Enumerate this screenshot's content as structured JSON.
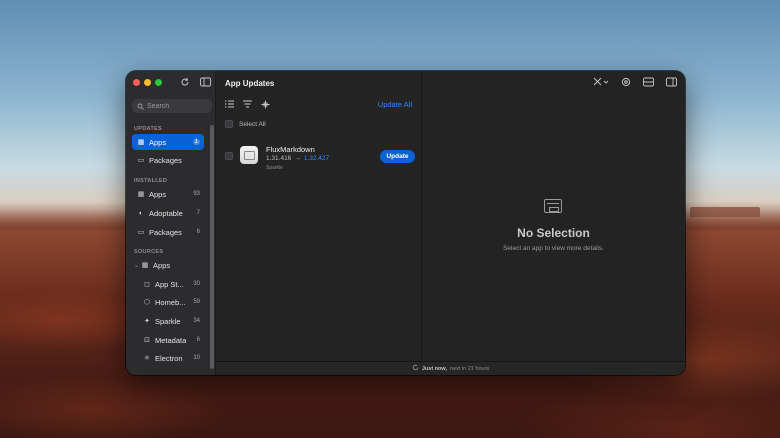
{
  "window": {
    "title": "App Updates"
  },
  "sidebar": {
    "search_placeholder": "Search",
    "sections": {
      "updates": "UPDATES",
      "installed": "INSTALLED",
      "sources": "SOURCES"
    },
    "updates_items": [
      {
        "label": "Apps",
        "count": "1",
        "icon": "grid-icon"
      },
      {
        "label": "Packages",
        "count": "",
        "icon": "package-icon"
      }
    ],
    "installed_items": [
      {
        "label": "Apps",
        "count": "93",
        "icon": "grid-icon"
      },
      {
        "label": "Adoptable",
        "count": "7",
        "icon": "adopt-icon"
      },
      {
        "label": "Packages",
        "count": "6",
        "icon": "package-icon"
      }
    ],
    "sources_group": {
      "label": "Apps",
      "icon": "grid-icon"
    },
    "sources_items": [
      {
        "label": "App St...",
        "count": "30",
        "icon": "bag-icon"
      },
      {
        "label": "Homeb...",
        "count": "59",
        "icon": "cube-icon"
      },
      {
        "label": "Sparkle",
        "count": "34",
        "icon": "sparkle-icon"
      },
      {
        "label": "Metadata",
        "count": "6",
        "icon": "metadata-icon"
      },
      {
        "label": "Electron",
        "count": "10",
        "icon": "atom-icon"
      }
    ]
  },
  "middle": {
    "update_all": "Update All",
    "select_all": "Select All",
    "app": {
      "name": "FluxMarkdown",
      "old_version": "1.31.416",
      "arrow": "→",
      "new_version": "1.32.427",
      "source": "Sparkle",
      "button": "Update"
    }
  },
  "detail": {
    "title": "No Selection",
    "subtitle": "Select an app to view more details."
  },
  "status": {
    "strong": "Just now,",
    "rest": "next in 21 hours"
  },
  "colors": {
    "accent": "#0a63d6",
    "link": "#2f8bff"
  }
}
